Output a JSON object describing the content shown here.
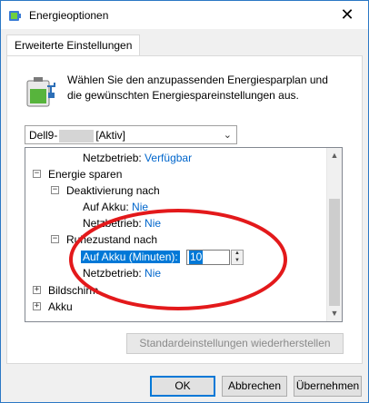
{
  "window": {
    "title": "Energieoptionen",
    "close_glyph": "✕"
  },
  "tab": {
    "label": "Erweiterte Einstellungen"
  },
  "header": {
    "text": "Wählen Sie den anzupassenden Energiesparplan und die gewünschten Energiespareinstellungen aus."
  },
  "plan_select": {
    "prefix": "Dell9-",
    "suffix": "[Aktiv]",
    "chevron": "⌄"
  },
  "tree": {
    "rows": [
      {
        "label": "Netzbetrieb:",
        "value": "Verfügbar"
      },
      {
        "expander": "−",
        "label": "Energie sparen"
      },
      {
        "expander": "−",
        "label": "Deaktivierung nach"
      },
      {
        "label": "Auf Akku:",
        "value": "Nie"
      },
      {
        "label": "Netzbetrieb:",
        "value": "Nie"
      },
      {
        "expander": "−",
        "label": "Ruhezustand nach"
      },
      {
        "label": "Auf Akku (Minuten):",
        "value": "10"
      },
      {
        "label": "Netzbetrieb:",
        "value": "Nie"
      },
      {
        "expander": "+",
        "label": "Bildschirm"
      },
      {
        "expander": "+",
        "label": "Akku"
      }
    ]
  },
  "restore_button": {
    "label": "Standardeinstellungen wiederherstellen"
  },
  "buttons": {
    "ok": "OK",
    "cancel": "Abbrechen",
    "apply": "Übernehmen"
  },
  "annotation": {
    "color": "#e3191b"
  }
}
